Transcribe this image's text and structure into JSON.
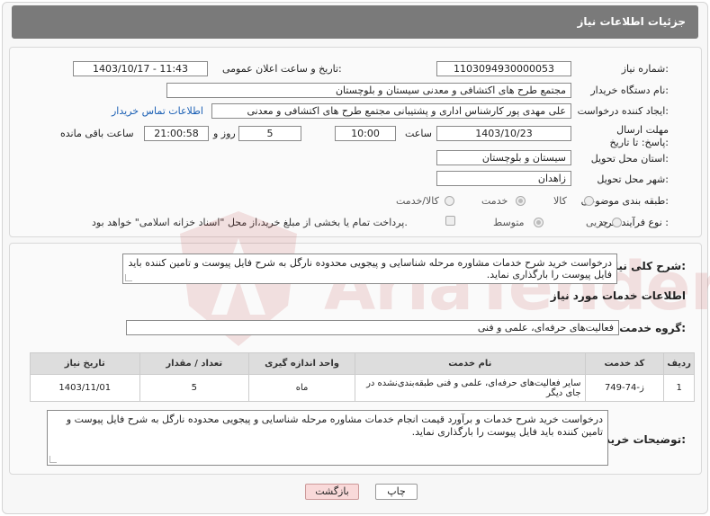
{
  "header": {
    "title": "جزئیات اطلاعات نیاز"
  },
  "fields": {
    "need_number_label": "شماره نیاز:",
    "need_number": "1103094930000053",
    "announce_label": "تاریخ و ساعت اعلان عمومی:",
    "announce_value": "1403/10/17 - 11:43",
    "buyer_org_label": "نام دستگاه خریدار:",
    "buyer_org": "مجتمع طرح های اکتشافی و معدنی سیستان و بلوچستان",
    "creator_label": "ایجاد کننده درخواست:",
    "creator": "علی مهدی پور کارشناس اداری و پشتیبانی مجتمع طرح های اکتشافی و معدنی",
    "contact_link": "اطلاعات تماس خریدار",
    "deadline_label": "مهلت ارسال پاسخ: تا تاریخ:",
    "deadline_date": "1403/10/23",
    "time_label": "ساعت",
    "deadline_time": "10:00",
    "days_value": "5",
    "days_label": "روز و",
    "remaining_time": "21:00:58",
    "remaining_label": "ساعت باقی مانده",
    "province_label": "استان محل تحویل:",
    "province": "سیستان و بلوچستان",
    "city_label": "شهر محل تحویل:",
    "city": "زاهدان",
    "category_label": "طبقه بندی موضوعی:",
    "category_options": [
      "کالا",
      "خدمت",
      "کالا/خدمت"
    ],
    "process_label": "نوع فرآیند خرید :",
    "process_options": [
      "جزیی",
      "متوسط"
    ],
    "payment_note": "پرداخت تمام یا بخشی از مبلغ خرید،از محل \"اسناد خزانه اسلامی\" خواهد بود."
  },
  "summary": {
    "label": "شرح کلی نیاز:",
    "text": "درخواست خرید شرح خدمات مشاوره مرحله شناسایی و پیجویی محدوده نارگل به شرح فایل پیوست و تامین کننده باید فایل پیوست را بارگذاری نماید."
  },
  "services": {
    "section_title": "اطلاعات خدمات مورد نیاز",
    "group_label": "گروه خدمت:",
    "group_value": "فعالیت‌های حرفه‌ای، علمی و فنی",
    "columns": [
      "ردیف",
      "کد خدمت",
      "نام خدمت",
      "واحد اندازه گیری",
      "تعداد / مقدار",
      "تاریخ نیاز"
    ],
    "rows": [
      {
        "row": "1",
        "code": "ز-74-749",
        "name": "سایر فعالیت‌های حرفه‌ای، علمی و فنی طبقه‌بندی‌نشده در جای دیگر",
        "unit": "ماه",
        "qty": "5",
        "date": "1403/11/01"
      }
    ]
  },
  "buyer_notes": {
    "label": "توضیحات خریدار:",
    "text": "درخواست خرید شرح خدمات و برآورد قیمت انجام خدمات مشاوره مرحله شناسایی و پیجویی محدوده نارگل به شرح فایل پیوست و تامین کننده باید فایل پیوست را بارگذاری نماید."
  },
  "buttons": {
    "print": "چاپ",
    "back": "بازگشت"
  },
  "watermark": {
    "brand": "AriaTender.neT"
  }
}
